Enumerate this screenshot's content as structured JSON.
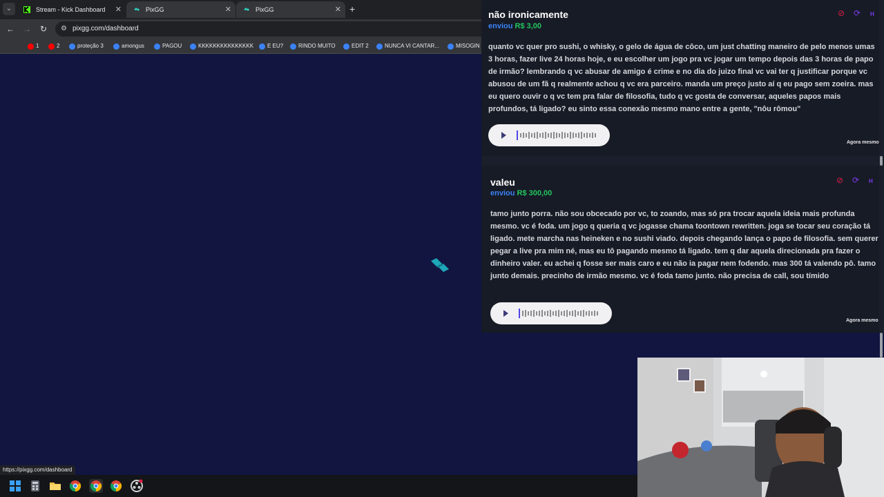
{
  "browser": {
    "tabs": [
      {
        "title": "Stream - Kick Dashboard",
        "icon": "kick-icon"
      },
      {
        "title": "PixGG",
        "icon": "pixgg-icon"
      },
      {
        "title": "PixGG",
        "icon": "pixgg-icon"
      }
    ],
    "url": "pixgg.com/dashboard",
    "status_url": "https://pixgg.com/dashboard",
    "bookmarks": [
      {
        "label": "1",
        "icon": "youtube-icon"
      },
      {
        "label": "2",
        "icon": "youtube-icon"
      },
      {
        "label": "proteção 3",
        "icon": "pixgg-icon"
      },
      {
        "label": "amongus",
        "icon": "pixgg-icon"
      },
      {
        "label": "PAGOU",
        "icon": "pixgg-icon"
      },
      {
        "label": "KKKKKKKKKKKKKKK",
        "icon": "pixgg-icon"
      },
      {
        "label": "E EU?",
        "icon": "pixgg-icon"
      },
      {
        "label": "RINDO MUITO",
        "icon": "pixgg-icon"
      },
      {
        "label": "EDIT 2",
        "icon": "pixgg-icon"
      },
      {
        "label": "NUNCA VI CANTAR...",
        "icon": "pixgg-icon"
      },
      {
        "label": "MISOGIN",
        "icon": "pixgg-icon"
      }
    ]
  },
  "donations": [
    {
      "name": "não ironicamente",
      "verb": "enviou",
      "amount": "R$ 3,00",
      "message": "quanto vc quer pro sushi, o whisky, o gelo de água de côco, um just chatting maneiro de pelo menos umas 3 horas, fazer live 24 horas hoje, e eu escolher um jogo pra vc jogar um tempo depois das 3 horas de papo de irmão? lembrando q vc abusar de amigo é crime e no dia do juizo final vc vai ter q justificar porque vc abusou de um fã q realmente achou q vc era parceiro. manda um preço justo aí q eu pago sem zoeira. mas eu quero ouvir o q vc tem pra falar de filosofia, tudo q vc gosta de conversar, aqueles papos mais profundos, tá ligado? eu sinto essa conexão mesmo mano entre a gente, \"nôu rômou\"",
      "time": "Agora mesmo"
    },
    {
      "name": "valeu",
      "verb": "enviou",
      "amount": "R$ 300,00",
      "message": "tamo junto porra. não sou obcecado por vc, to zoando, mas só pra trocar aquela ideia mais profunda mesmo. vc é foda. um jogo q queria q vc jogasse chama toontown rewritten. joga se tocar seu coração tá ligado. mete marcha nas heineken e no sushi viado. depois chegando lança o papo de filosofia. sem querer pegar a live pra mim né, mas eu tô pagando mesmo tá ligado. tem q dar aquela direcionada pra fazer o dinheiro valer. eu achei q fosse ser mais caro e eu não ia pagar nem fodendo. mas 300 tá valendo pô. tamo junto demais. precinho de irmão mesmo. vc é foda tamo junto. não precisa de call, sou tímido",
      "time": "Agora mesmo"
    }
  ],
  "colors": {
    "page_bg": "#111540",
    "verb": "#3b82f6",
    "amount": "#22c55e",
    "ban": "#e11d48",
    "accent": "#7c3aed"
  }
}
